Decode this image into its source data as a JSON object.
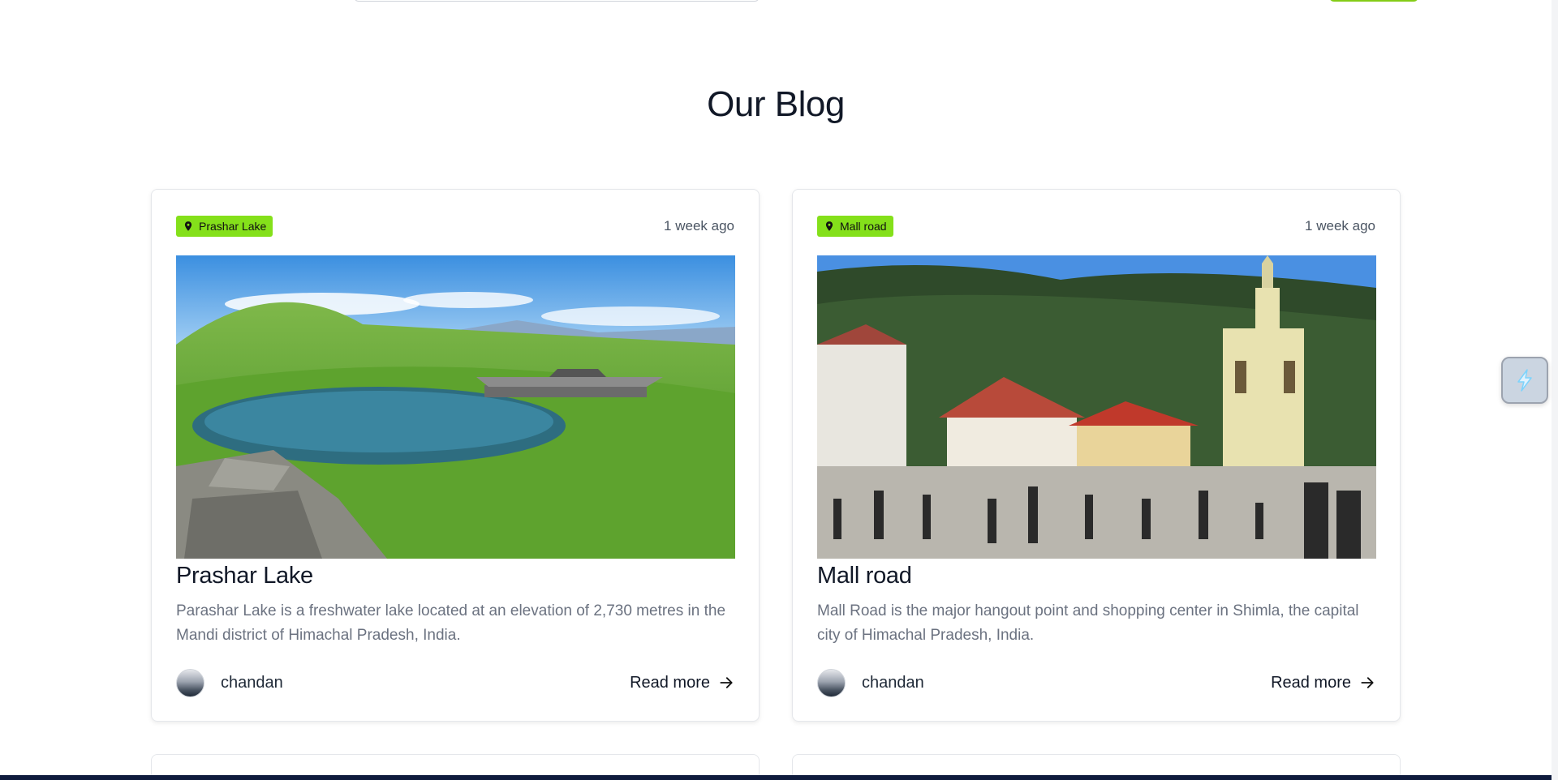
{
  "header": {},
  "section": {
    "title": "Our Blog"
  },
  "posts": [
    {
      "location": "Prashar Lake",
      "time_ago": "1 week ago",
      "title": "Prashar Lake",
      "description": "Parashar Lake is a freshwater lake located at an elevation of 2,730 metres in the Mandi district of Himachal Pradesh, India.",
      "author": "chandan",
      "read_more": "Read more",
      "image_subject": "mountain lake with temple"
    },
    {
      "location": "Mall road",
      "time_ago": "1 week ago",
      "title": "Mall road",
      "description": "Mall Road is the major hangout point and shopping center in Shimla, the capital city of Himachal Pradesh, India.",
      "author": "chandan",
      "read_more": "Read more",
      "image_subject": "town square with church and crowd"
    }
  ],
  "icons": {
    "location": "map-pin-icon",
    "arrow": "arrow-right-icon",
    "widget": "lightning-widget-icon"
  },
  "colors": {
    "badge": "#84e01a",
    "title": "#111827",
    "muted": "#6b7280",
    "footer_bar": "#0f1b3d"
  }
}
